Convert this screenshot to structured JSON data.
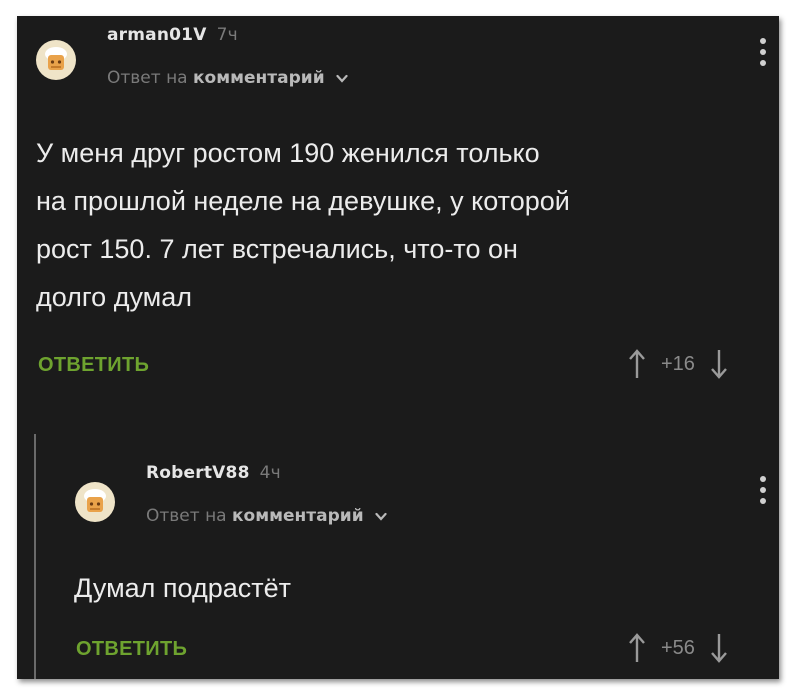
{
  "comments": [
    {
      "author": "arman01V",
      "time": "7ч",
      "reply_prefix": "Ответ на",
      "reply_target": "комментарий",
      "text_lines": [
        "У меня друг ростом 190 женился только",
        "на прошлой неделе на девушке, у которой",
        "рост 150. 7 лет встречались, что-то он",
        "долго думал"
      ],
      "reply_label": "ОТВЕТИТЬ",
      "rating": "+16",
      "upvote_icon": "arrow-up-icon",
      "downvote_icon": "arrow-down-icon"
    },
    {
      "author": "RobertV88",
      "time": "4ч",
      "reply_prefix": "Ответ на",
      "reply_target": "комментарий",
      "text_lines": [
        "Думал подрастёт"
      ],
      "reply_label": "ОТВЕТИТЬ",
      "rating": "+56",
      "upvote_icon": "arrow-up-icon",
      "downvote_icon": "arrow-down-icon"
    }
  ],
  "colors": {
    "background": "#1b1b1b",
    "accent_green": "#6ea32f",
    "text": "#ececec",
    "muted": "#7a7a7a"
  }
}
